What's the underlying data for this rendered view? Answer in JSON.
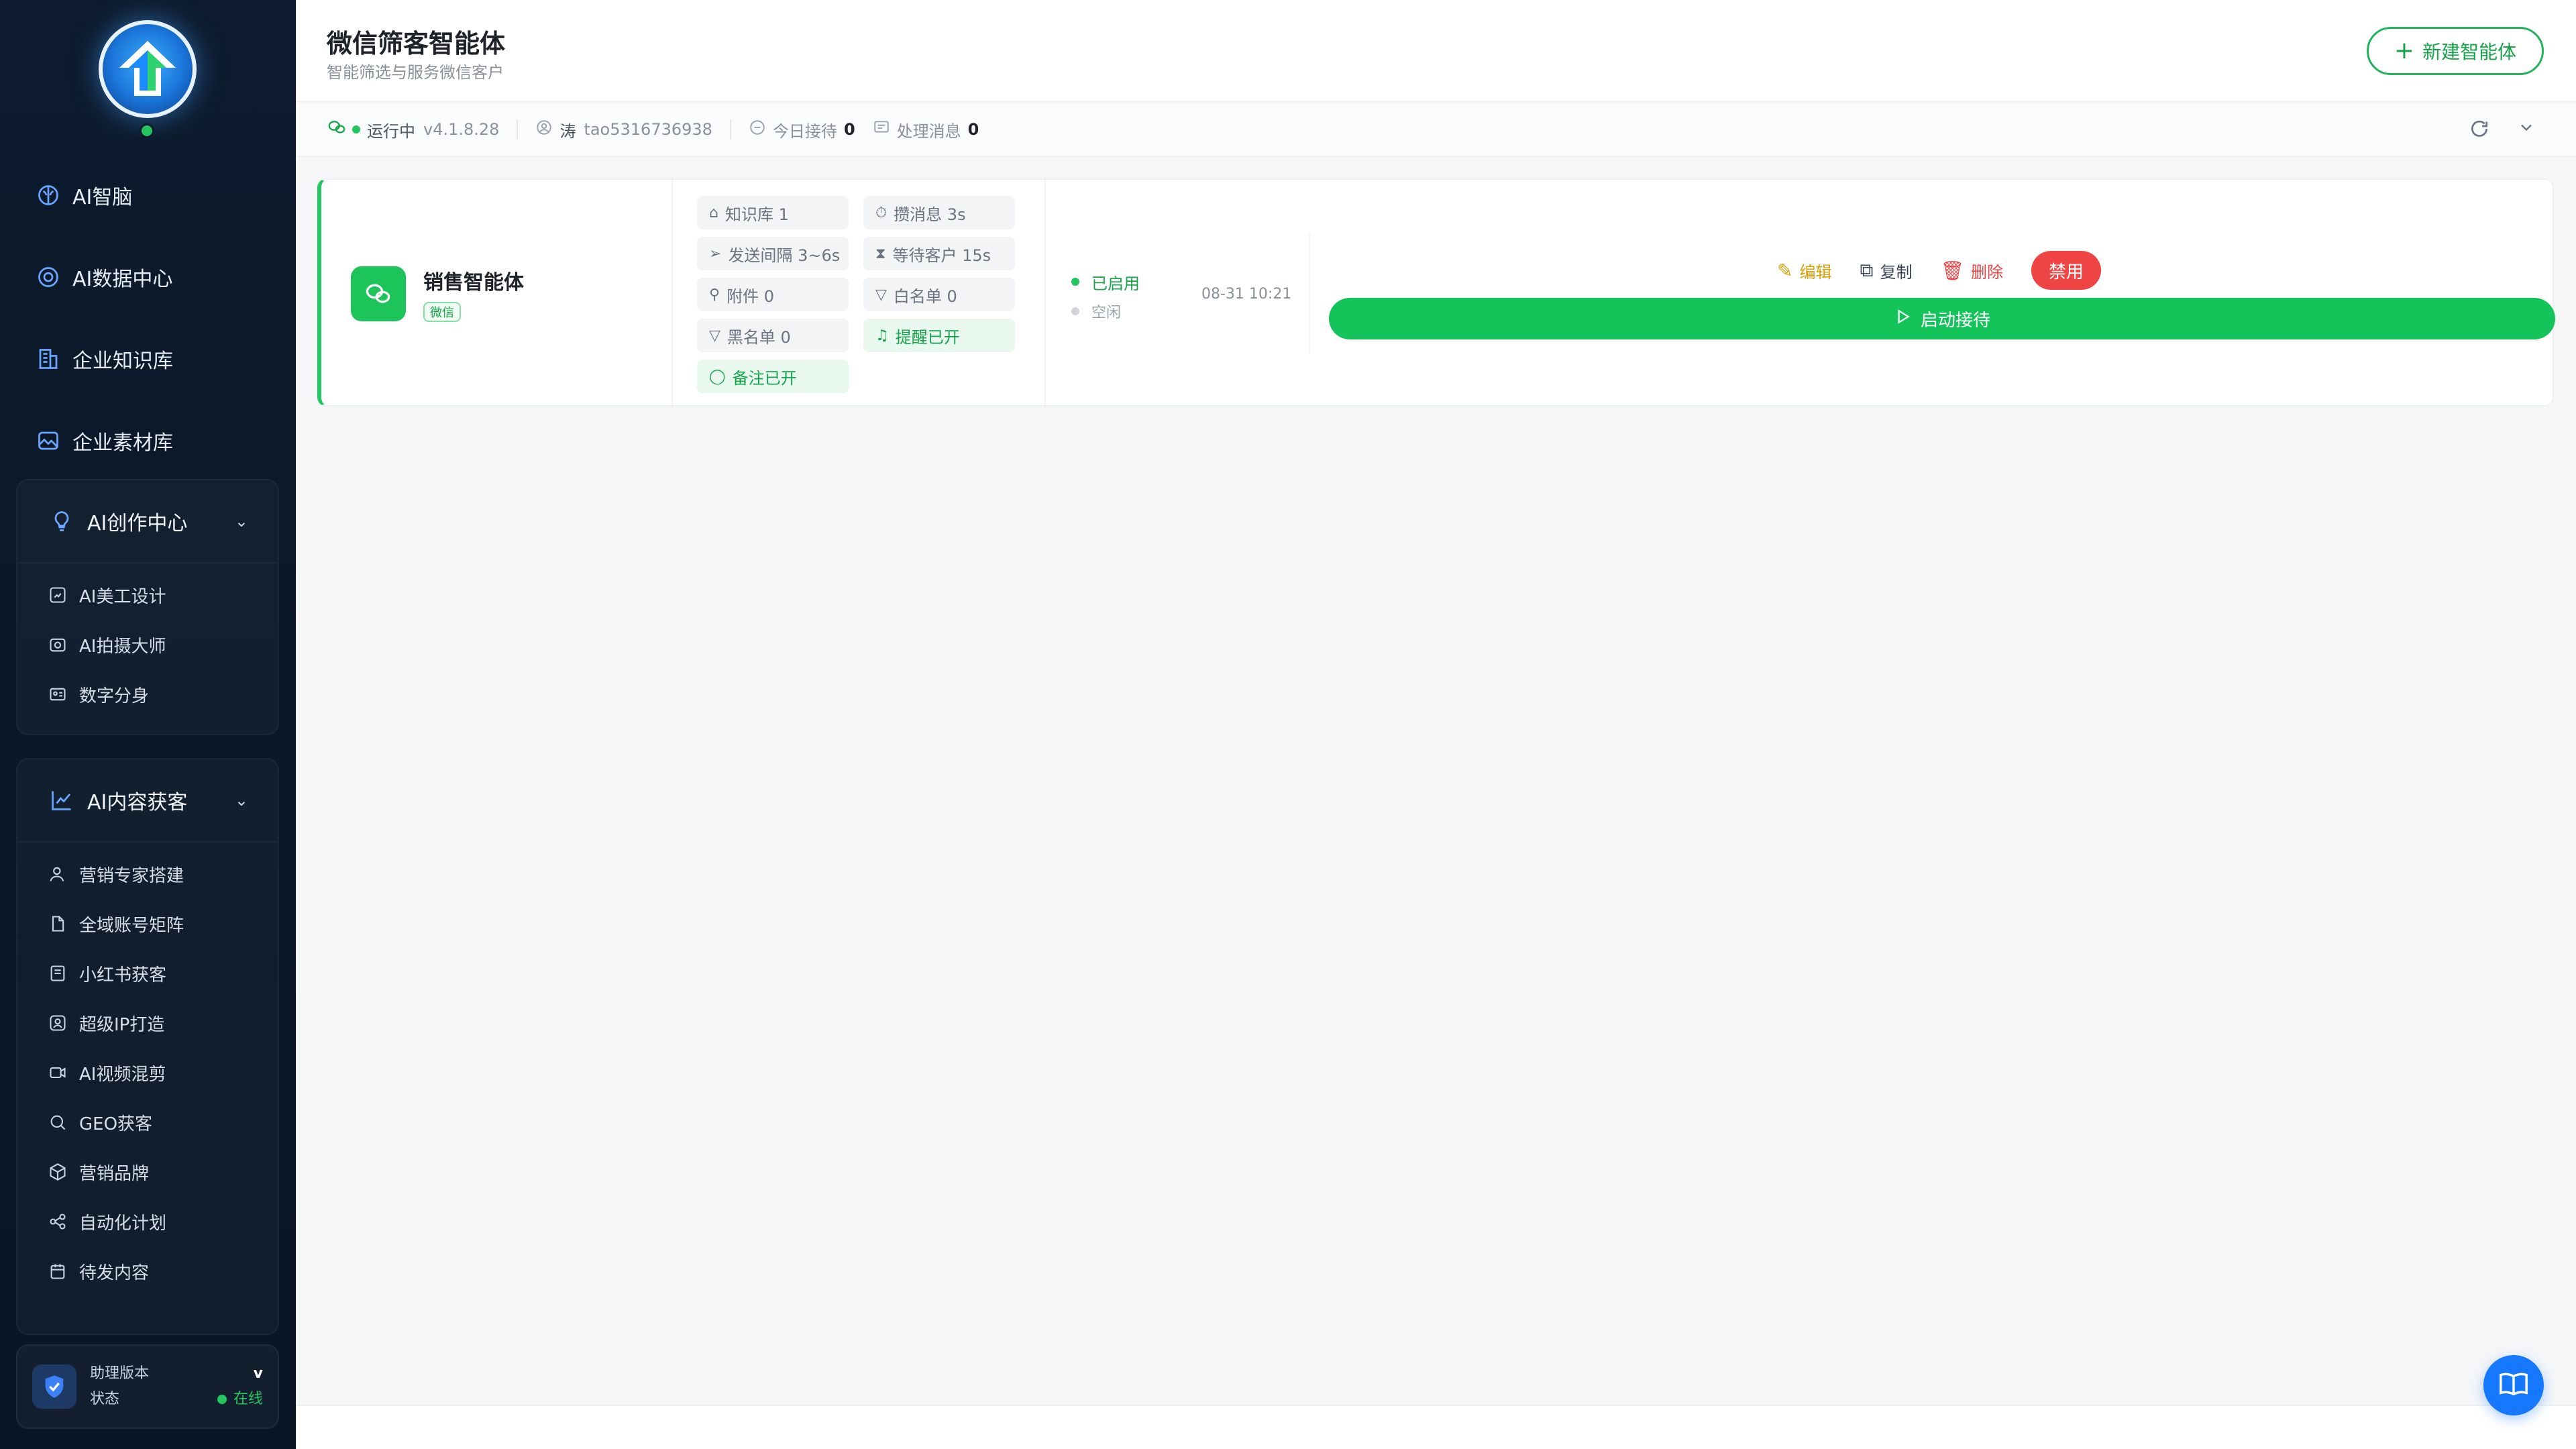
{
  "sidebar": {
    "top_items": [
      {
        "label": "AI智脑",
        "icon": "brain-icon"
      },
      {
        "label": "AI数据中心",
        "icon": "data-center-icon"
      },
      {
        "label": "企业知识库",
        "icon": "building-icon"
      },
      {
        "label": "企业素材库",
        "icon": "image-library-icon"
      }
    ],
    "group1": {
      "label": "AI创作中心",
      "items": [
        {
          "label": "AI美工设计",
          "icon": "design-icon"
        },
        {
          "label": "AI拍摄大师",
          "icon": "camera-icon"
        },
        {
          "label": "数字分身",
          "icon": "id-card-icon"
        }
      ]
    },
    "group2": {
      "label": "AI内容获客",
      "items": [
        {
          "label": "营销专家搭建",
          "icon": "user-icon"
        },
        {
          "label": "全域账号矩阵",
          "icon": "file-icon"
        },
        {
          "label": "小红书获客",
          "icon": "book-icon"
        },
        {
          "label": "超级IP打造",
          "icon": "profile-icon"
        },
        {
          "label": "AI视频混剪",
          "icon": "video-icon"
        },
        {
          "label": "GEO获客",
          "icon": "search-icon"
        },
        {
          "label": "营销品牌",
          "icon": "box-icon"
        },
        {
          "label": "自动化计划",
          "icon": "share-icon"
        },
        {
          "label": "待发内容",
          "icon": "calendar-icon"
        }
      ]
    },
    "status_card": {
      "version_label": "助理版本",
      "version_value": "v",
      "state_label": "状态",
      "state_value": "在线"
    }
  },
  "header": {
    "title": "微信筛客智能体",
    "subtitle": "智能筛选与服务微信客户",
    "new_button": "新建智能体"
  },
  "statusbar": {
    "running": "运行中",
    "version": "v4.1.8.28",
    "user_name": "涛",
    "user_id": "tao5316736938",
    "today_label": "今日接待",
    "today_value": "0",
    "msg_label": "处理消息",
    "msg_value": "0"
  },
  "agent_card": {
    "name": "销售智能体",
    "tag": "微信",
    "tags": {
      "knowledge": "知识库 1",
      "accumulate": "攒消息 3s",
      "interval": "发送间隔 3~6s",
      "waiting": "等待客户 15s",
      "attachment": "附件 0",
      "whitelist": "白名单 0",
      "blacklist": "黑名单 0",
      "reminder": "提醒已开",
      "notes": "备注已开"
    },
    "status_enabled": "已启用",
    "status_idle": "空闲",
    "time": "08-31 10:21",
    "actions": {
      "edit": "编辑",
      "copy": "复制",
      "delete": "删除",
      "disable": "禁用",
      "start": "启动接待"
    }
  },
  "colors": {
    "sidebar_bg": "#0d1b2e",
    "accent_green": "#14c45a",
    "danger": "#ef4444",
    "edit_yellow": "#d4a106",
    "fab_blue": "#1677ff"
  }
}
